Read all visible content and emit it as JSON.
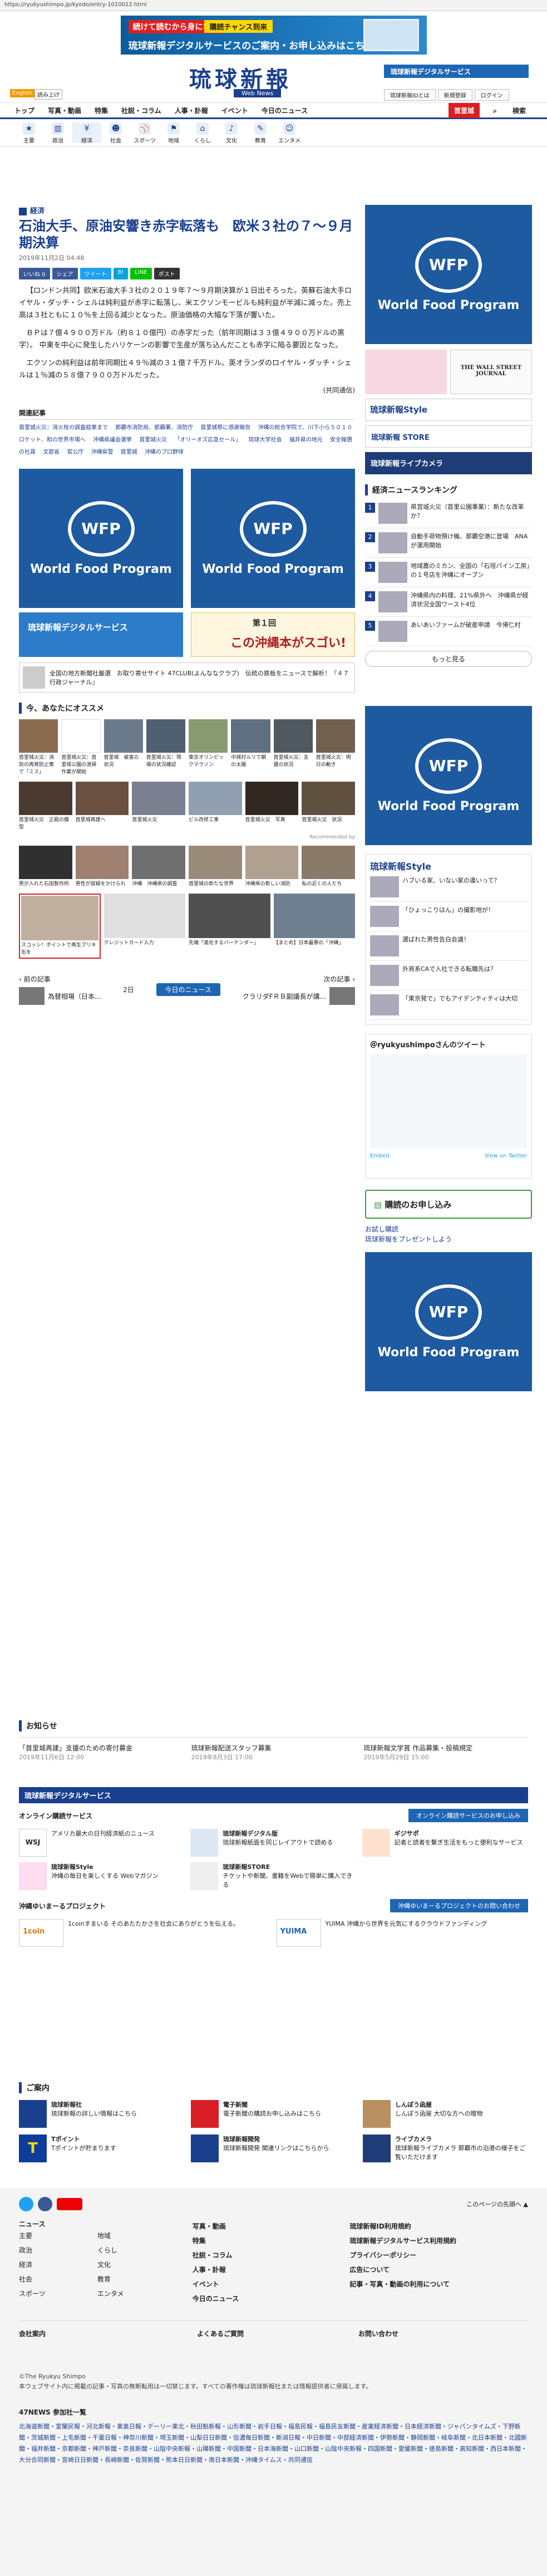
{
  "address": "https://ryukyushimpo.jp/kyodo/entry-1010012.html",
  "top_banner": {
    "tag1": "続けて読むから身になる",
    "tag2": "購読チャンス到来",
    "text": "琉球新報デジタルサービスのご案内・お申し込みはこちら"
  },
  "header": {
    "logo": "琉球新報",
    "logo_sub": "Web News",
    "digital_btn": "琉球新報デジタルサービス",
    "english": "English",
    "yomi": "読み上げ",
    "util": [
      "琉球新報IDとは",
      "新規登録",
      "ログイン"
    ]
  },
  "gnav": [
    "トップ",
    "写真・動画",
    "特集",
    "社説・コラム",
    "人事・訃報",
    "イベント",
    "今日のニュース"
  ],
  "gnav_red": "首里城",
  "search": "検索",
  "cnav": [
    "主要",
    "政治",
    "経済",
    "社会",
    "スポーツ",
    "地域",
    "くらし",
    "文化",
    "教育",
    "エンタメ"
  ],
  "article": {
    "category": "経済",
    "headline": "石油大手、原油安響き赤字転落も　欧米３社の７～９月期決算",
    "date": "2019年11月2日 04:48",
    "share": [
      "いいね 0",
      "シェア",
      "ツイート",
      "B!",
      "LINE",
      "ポスト"
    ],
    "p1": "【ロンドン共同】欧米石油大手３社の２０１９年７～９月期決算が１日出そろった。英蘇石油大手ロイヤル・ダッチ・シェルは純利益が赤字に転落し、米エクソンモービルも純利益が半減に減った。売上高は３社ともに１０％を上回る減少となった。原油価格の大幅な下落が響いた。",
    "p2": "ＢＰは７億４９００万ドル（約８１０億円）の赤字だった（前年同期は３３億４９００万ドルの黒字）。 中東を中心に発生したハリケーンの影響で生産が落ち込んだことも赤字に陥る要因となった。",
    "p3": "エクソンの純利益は前年同期比４９％減の３１億７千万ドル。英オランダのロイヤル・ダッチ・シェルは１％減の５８億７９００万ドルだった。",
    "source": "(共同通信)",
    "kw_title": "関連記事",
    "keywords": [
      "首里城火災：消火栓の調査結果まで",
      "那覇市消防局、那覇署、消防庁",
      "首里城祭に感謝報告",
      "沖縄の総合学院で、川下小ら５０１０ロケット、和の世界市場へ",
      "沖縄県議会選挙",
      "首里城火災",
      "「オリーオズ応急セール」",
      "琉球大学社会",
      "福井県の地元",
      "安全報償の社員",
      "文部省",
      "官公庁",
      "沖縄県警",
      "首里城",
      "沖縄のプロ野球"
    ]
  },
  "ads": {
    "wfp": "World Food Program",
    "wfp_em": "WFP",
    "okinawa_hon": "この沖縄本がスゴい!",
    "okinawa_no": "第１回",
    "small_ad_text": "全国の地方新聞社厳選　お取り寄せサイト 47CLUB(よんななクラブ)　伝統の鉄板をニュースで解析！『４７行政ジャーナル』",
    "digital_service": "琉球新報デジタルサービス"
  },
  "recommend": {
    "title": "今、あなたにオススメ",
    "row1": [
      "首里城火災：消防の再発防止策で「ミス」",
      "首里城火災：首里城公園の清掃作業が開始",
      "首里城　被害の状況",
      "首里城火災：現場の状況確認",
      "東京オリンピックマラソン",
      "中城村ルリで朝の太陽",
      "首里城火災：支援の状況",
      "首里城火災：明日の動き"
    ],
    "row2": [
      "首里城火災　正殿の模型",
      "首里城再建へ",
      "首里城火災",
      "ビル改修工事",
      "首里城火災　写真",
      "首里城火災　状況"
    ],
    "row3": [
      "男が入れた石田製作所",
      "男性が容疑をかけられ",
      "沖縄　沖縄県の調査",
      "首里城の新たな世界",
      "沖縄県の新しい消防",
      "私の近くの人たち"
    ],
    "row4": [
      "スコッシ！ポイントで再生ブリキ缶を",
      "クレジットカード入力",
      "先端「進化するバーテンダー」",
      "【まとめ】日本最悪の「沖縄」"
    ],
    "recommend_by": "Recommended by"
  },
  "pager": {
    "prev": "前の記事",
    "prev_t": "為替相場（日本...",
    "today": "今日のニュース",
    "next": "次の記事",
    "next_t": "クラリダFＲＢ副議長が講...",
    "day": "2日"
  },
  "ranking": {
    "title": "経済ニュースランキング",
    "items": [
      {
        "n": "1",
        "t": "県営城火災（首里公園事業）：新たな改革か？"
      },
      {
        "n": "2",
        "t": "自動手荷物預け機、那覇空港に登場　ANAが運用開始"
      },
      {
        "n": "3",
        "t": "地域農のミカン、全国の「石垣パイン工房」の１号店を沖縄にオープン"
      },
      {
        "n": "4",
        "t": "沖縄県内の料理、21%県外へ　沖縄県が経済状況全国ワースト4位"
      },
      {
        "n": "5",
        "t": "あいあいファームが破産申請　今帰仁村"
      }
    ],
    "more": "もっと見る"
  },
  "side_style": {
    "title": "琉球新報Style",
    "items": [
      "ハブいる家、いない家の違いって？",
      "「ひょっこりはん」の撮影地が！",
      "選ばれた男性告白会議！",
      "外資系CAで入社できる転職先は？",
      "「東京発で」でもアイデンティティは大切"
    ]
  },
  "side_twitter": {
    "title": "＠ryukyushimpoさんのツイート",
    "by": "Embed",
    "view": "View on Twitter"
  },
  "side_subscribe": {
    "btn": "購読のお申し込み",
    "link1": "お試し購読",
    "link2": "琉球新報をプレゼントしよう"
  },
  "notice": {
    "title": "お知らせ",
    "items": [
      {
        "t": "「首里城再建」支援のための寄付募金",
        "d": "2019年11月6日 12:00"
      },
      {
        "t": "琉球新報配送スタッフ募集",
        "d": "2019年8月3日 17:00"
      },
      {
        "t": "琉球新報文学賞 作品募集・投稿規定",
        "d": "2019年5月29日 15:00"
      }
    ]
  },
  "digital": {
    "title": "琉球新報デジタルサービス",
    "online_title": "オンライン購読サービス",
    "online_btn": "オンライン購読サービスのお申し込み",
    "items": [
      {
        "n": "WSJ",
        "t": "アメリカ最大の日刊経済紙のニュース"
      },
      {
        "n": "琉球新報デジタル版",
        "t": "琉球新報紙面を同じレイアウトで読める"
      },
      {
        "n": "ギジサポ",
        "t": "記者と読者を繋ぎ生活をもっと便利なサービス"
      },
      {
        "n": "琉球新報Style",
        "t": "沖縄の毎日を楽しくする Webマガジン"
      },
      {
        "n": "琉球新報STORE",
        "t": "チケットや新聞、書籍をWebで簡単に購入できる"
      }
    ],
    "project_title": "沖縄ゆいまーるプロジェクト",
    "project_btn": "沖縄ゆいまーるプロジェクトのお問い合わせ",
    "projects": [
      {
        "n": "1coin",
        "t": "1coinすまいる そのあたたかさを社会にありがとうを伝える。"
      },
      {
        "n": "YUIMA",
        "t": "YUIMA 沖縄から世界を元気にするクラウドファンディング"
      }
    ]
  },
  "guide": {
    "title": "ご案内",
    "items": [
      {
        "n": "琉球新報社",
        "t": "琉球新報の詳しい情報はこちら"
      },
      {
        "n": "電子新聞",
        "t": "電子新聞の購読お申し込みはこちら"
      },
      {
        "n": "しんぽう函屋",
        "t": "しんぽう函屋 大切な方への贈物"
      },
      {
        "n": "Tポイント",
        "t": "Tポイントが貯まります"
      },
      {
        "n": "琉球新報開発",
        "t": "琉球新報開発 関連リンクはこちらから"
      },
      {
        "n": "ライブカメラ",
        "t": "琉球新報ライブカメラ 那覇市の泊港の様子をご覧いただけます"
      }
    ]
  },
  "footer": {
    "social": "このページの先頭へ",
    "news_title": "ニュース",
    "news": [
      "主要",
      "政治",
      "経済",
      "社会",
      "スポーツ",
      "地域",
      "くらし",
      "文化",
      "教育",
      "エンタメ"
    ],
    "col2": [
      "写真・動画",
      "特集",
      "社説・コラム",
      "人事・訃報",
      "イベント",
      "今日のニュース"
    ],
    "col3": [
      "琉球新報ID利用規約",
      "琉球新報デジタルサービス利用規約",
      "プライバシーポリシー",
      "広告について",
      "記事・写真・動画の利用について"
    ],
    "company": "会社案内",
    "faq": "よくあるご質問",
    "contact": "お問い合わせ",
    "copyright": "©The Ryukyu Shimpo",
    "copy_note": "本ウェブサイト内に掲載の記事・写真の無断転用は一切禁じます。すべての著作権は琉球新報社または情報提供者に帰属します。",
    "47news": "47NEWS 参加社一覧",
    "47list": "北海道新聞・室蘭民報・河北新報・東奥日報・デーリー東北・秋田魁新報・山形新聞・岩手日報・福島民報・福島民友新聞・産業経済新聞・日本経済新聞・ジャパンタイムズ・下野新聞・茨城新聞・上毛新聞・千葉日報・神奈川新聞・埼玉新聞・山梨日日新聞・信濃毎日新聞・新潟日報・中日新聞・中部経済新聞・伊勢新聞・静岡新聞・岐阜新聞・北日本新聞・北國新聞・福井新聞・京都新聞・神戸新聞・奈良新聞・山陰中央新報・山陽新聞・中国新聞・日本海新聞・山口新聞・山陰中央新報・四国新聞・愛媛新聞・徳島新聞・高知新聞・西日本新聞・大分合同新聞・宮崎日日新聞・長崎新聞・佐賀新聞・熊本日日新聞・南日本新聞・沖縄タイムス・共同通信"
  },
  "colors": {
    "brand": "#1a3f8f",
    "accent": "#d81f26",
    "ad_blue": "#1d5aa0"
  }
}
